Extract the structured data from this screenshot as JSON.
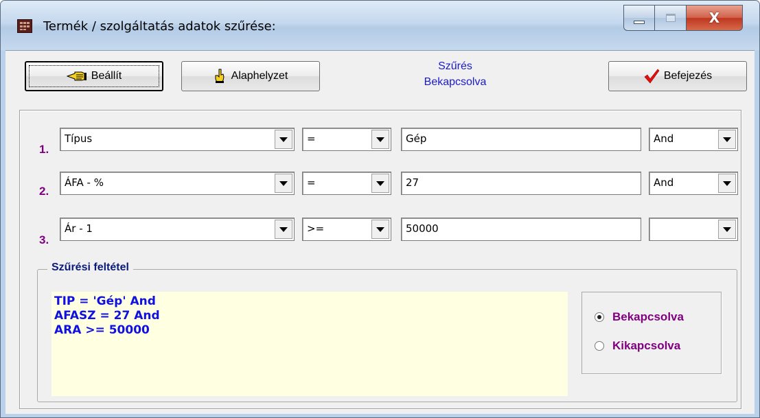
{
  "window": {
    "title": "Termék / szolgáltatás adatok szűrése:",
    "close_glyph": "X"
  },
  "toolbar": {
    "set_label": "Beállít",
    "reset_label": "Alaphelyzet",
    "finish_label": "Befejezés",
    "status_line1": "Szűrés",
    "status_line2": "Bekapcsolva"
  },
  "rows": [
    {
      "num": "1.",
      "field": "Típus",
      "operator": "=",
      "value": "Gép",
      "logic": "And"
    },
    {
      "num": "2.",
      "field": "ÁFA - %",
      "operator": "=",
      "value": "27",
      "logic": "And"
    },
    {
      "num": "3.",
      "field": "Ár - 1",
      "operator": ">=",
      "value": "50000",
      "logic": ""
    }
  ],
  "filter": {
    "group_label": "Szűrési feltétel",
    "lines": [
      "TIP = 'Gép' And",
      "AFASZ = 27 And",
      "ARA >= 50000"
    ],
    "radio_on": "Bekapcsolva",
    "radio_off": "Kikapcsolva",
    "selected": "on"
  },
  "colors": {
    "status_text": "#1a1acc",
    "row_number": "#800080",
    "filter_text": "#1010e0",
    "filter_bg": "#ffffe1"
  }
}
